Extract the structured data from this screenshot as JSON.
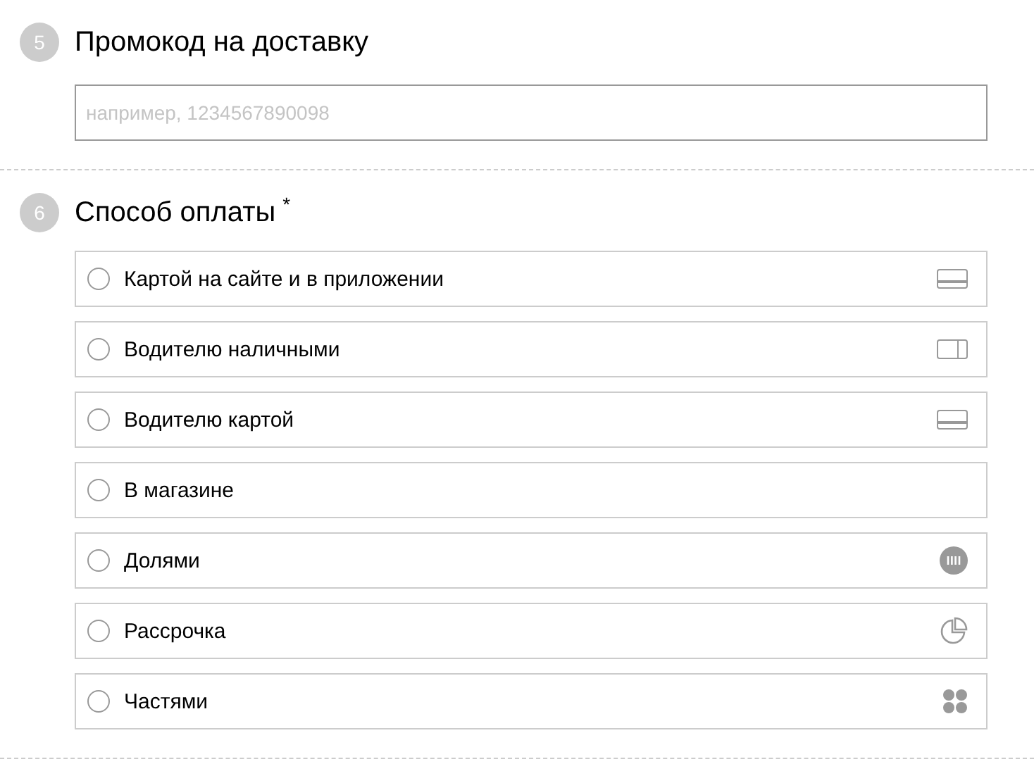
{
  "sections": [
    {
      "number": "5",
      "title": "Промокод на доставку",
      "field": {
        "placeholder": "например, 1234567890098"
      }
    },
    {
      "number": "6",
      "title": "Способ оплаты",
      "required_mark": "*",
      "options": [
        {
          "label": "Картой на сайте и в приложении",
          "selected": false,
          "kind": "card"
        },
        {
          "label": "Водителю наличными",
          "selected": false,
          "kind": "cash"
        },
        {
          "label": "Водителю картой",
          "selected": false,
          "kind": "card"
        },
        {
          "label": "В магазине",
          "selected": false
        },
        {
          "label": "Долями",
          "selected": false,
          "kind": "shares"
        },
        {
          "label": "Рассрочка",
          "selected": false,
          "kind": "installment"
        },
        {
          "label": "Частями",
          "selected": false,
          "kind": "parts"
        }
      ]
    }
  ]
}
